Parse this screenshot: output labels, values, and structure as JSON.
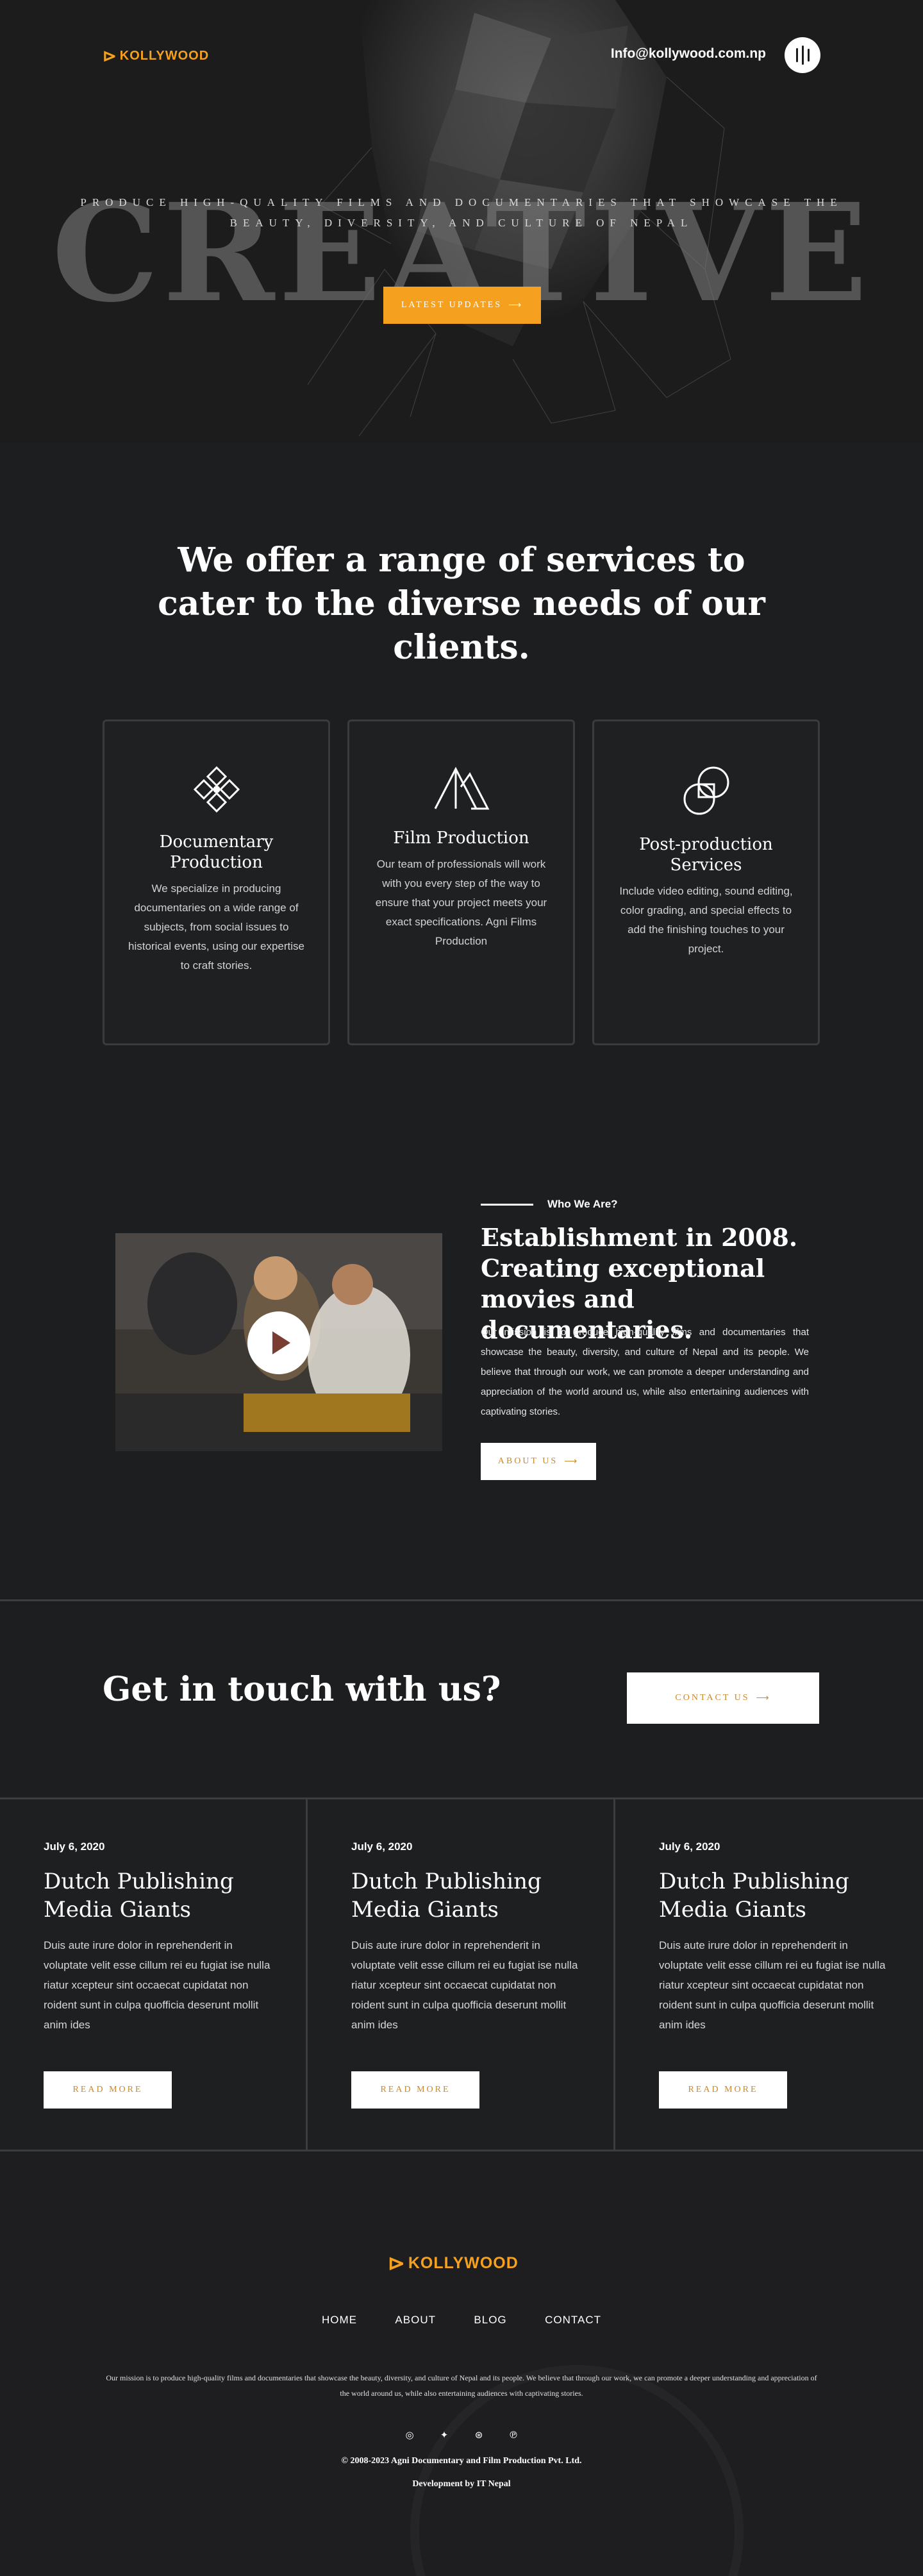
{
  "brand": {
    "name": "KOLLYWOOD",
    "accent": "#f5a01e"
  },
  "header": {
    "email": "Info@kollywood.com.np"
  },
  "hero": {
    "tagline": "PRODUCE HIGH-QUALITY FILMS AND DOCUMENTARIES THAT SHOWCASE THE BEAUTY, DIVERSITY, AND CULTURE OF NEPAL",
    "big_word": "CREATIVE",
    "button_label": "LATEST UPDATES"
  },
  "services": {
    "title": "We offer a range of services to cater to the diverse needs of our clients.",
    "cards": [
      {
        "icon": "diamond-arrows-icon",
        "title": "Documentary Production",
        "text": "We specialize in producing documentaries on a wide range of subjects, from social issues to historical events, using our expertise to craft stories."
      },
      {
        "icon": "mountain-icon",
        "title": "Film Production",
        "text": "Our team of professionals will work with you every step of the way to ensure that your project meets your exact specifications. Agni Films Production"
      },
      {
        "icon": "overlap-squares-icon",
        "title": "Post-production Services",
        "text": "Include video editing, sound editing, color grading, and special effects to add the finishing touches to your project."
      }
    ]
  },
  "about": {
    "kicker": "Who We Are?",
    "title": "Establishment in 2008. Creating exceptional movies and documentaries.",
    "text": "Our mission is to produce high-quality films and documentaries that showcase the beauty, diversity, and culture of Nepal and its people. We believe that through our work, we can promote a deeper understanding and appreciation of the world around us, while also entertaining audiences with captivating stories.",
    "button_label": "ABOUT US"
  },
  "contact": {
    "title": "Get in touch with us?",
    "button_label": "CONTACT US"
  },
  "blog": {
    "posts": [
      {
        "date": "July 6, 2020",
        "title": "Dutch Publishing Media Giants",
        "excerpt": "Duis aute irure dolor in reprehenderit in voluptate velit esse cillum rei eu fugiat ise nulla riatur xcepteur sint occaecat cupidatat non roident sunt in culpa quofficia deserunt mollit anim ides",
        "button_label": "READ MORE"
      },
      {
        "date": "July 6, 2020",
        "title": "Dutch Publishing Media Giants",
        "excerpt": "Duis aute irure dolor in reprehenderit in voluptate velit esse cillum rei eu fugiat ise nulla riatur xcepteur sint occaecat cupidatat non roident sunt in culpa quofficia deserunt mollit anim ides",
        "button_label": "READ MORE"
      },
      {
        "date": "July 6, 2020",
        "title": "Dutch Publishing Media Giants",
        "excerpt": "Duis aute irure dolor in reprehenderit in voluptate velit esse cillum rei eu fugiat ise nulla riatur xcepteur sint occaecat cupidatat non roident sunt in culpa quofficia deserunt mollit anim ides",
        "button_label": "READ MORE"
      }
    ]
  },
  "footer": {
    "nav": [
      "HOME",
      "ABOUT",
      "BLOG",
      "CONTACT"
    ],
    "description": "Our mission is to produce high-quality films and documentaries that showcase the beauty, diversity, and culture of Nepal and its people. We believe that through our work, we can promote a deeper understanding and appreciation of the world around us, while also entertaining audiences with captivating stories.",
    "social": [
      "instagram-icon",
      "twitter-icon",
      "dribbble-icon",
      "pinterest-icon"
    ],
    "copyright": "© 2008-2023 Agni Documentary and Film Production Pvt. Ltd.",
    "developer": "Development by IT Nepal"
  }
}
